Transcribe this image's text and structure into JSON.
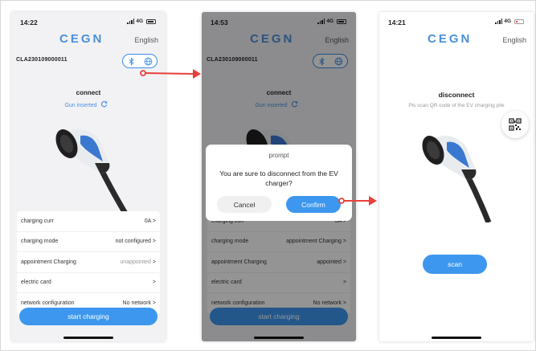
{
  "colors": {
    "accent": "#3d97ee",
    "arrow": "#e8403a",
    "highlight_blue": "#4a90e2"
  },
  "logo": "CEGN",
  "screen1": {
    "time": "14:22",
    "network": "4G",
    "language": "English",
    "device_id": "CLA230109000011",
    "status_title": "connect",
    "status_sub": "Gun inserted",
    "rows": [
      {
        "label": "charging curr",
        "value": "0A",
        "chevron": ">"
      },
      {
        "label": "charging mode",
        "value": "not configured",
        "chevron": ">"
      },
      {
        "label": "appointment Charging",
        "value": "unappointed",
        "chevron": ">"
      },
      {
        "label": "electric card",
        "value": "",
        "chevron": ">"
      },
      {
        "label": "network configuration",
        "value": "No network",
        "chevron": ">"
      }
    ],
    "start_button": "start charging",
    "icons": [
      "bluetooth-icon",
      "globe-icon",
      "refresh-icon"
    ]
  },
  "screen2": {
    "time": "14:53",
    "network": "4G",
    "language": "English",
    "device_id": "CLA230109000011",
    "status_title": "connect",
    "status_sub": "Gun inserted",
    "rows": [
      {
        "label": "charging curr",
        "value": "0A",
        "chevron": ">"
      },
      {
        "label": "charging mode",
        "value": "appointment Charging",
        "chevron": ">"
      },
      {
        "label": "appointment Charging",
        "value": "appointed",
        "chevron": ">"
      },
      {
        "label": "electric card",
        "value": "",
        "chevron": ">"
      },
      {
        "label": "network configuration",
        "value": "No network",
        "chevron": ">"
      }
    ],
    "start_button": "start charging",
    "dialog": {
      "title": "prompt",
      "message": "You are sure to disconnect from the EV charger?",
      "cancel": "Cancel",
      "confirm": "Confirm"
    }
  },
  "screen3": {
    "time": "14:21",
    "network": "4G",
    "language": "English",
    "status_title": "disconnect",
    "status_sub": "Pls scan QR code of the EV charging pile",
    "scan_button": "scan",
    "icons": [
      "qr-code-icon"
    ]
  }
}
